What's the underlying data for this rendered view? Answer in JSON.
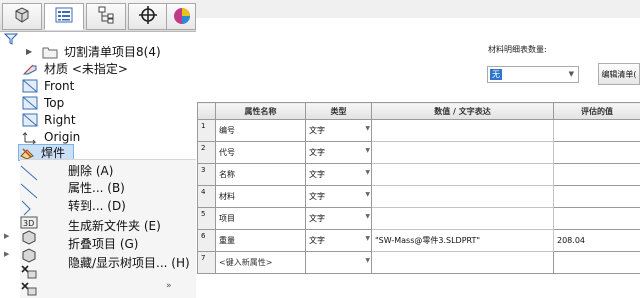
{
  "tabs": [
    {
      "icon": "feature-manager-icon"
    },
    {
      "icon": "property-manager-icon"
    },
    {
      "icon": "configuration-manager-icon"
    },
    {
      "icon": "dimxpert-icon"
    },
    {
      "icon": "display-manager-icon"
    }
  ],
  "tree": {
    "items": [
      {
        "label": "切割清单项目8(4)",
        "icon": "folder-icon"
      },
      {
        "label": "材质 <未指定>",
        "icon": "material-icon"
      },
      {
        "label": "Front",
        "icon": "plane-icon"
      },
      {
        "label": "Top",
        "icon": "plane-icon"
      },
      {
        "label": "Right",
        "icon": "plane-icon"
      },
      {
        "label": "Origin",
        "icon": "origin-icon"
      },
      {
        "label": "焊件",
        "icon": "weldment-icon",
        "selected": true
      }
    ]
  },
  "context_menu": {
    "items": [
      {
        "label": "删除 (A)"
      },
      {
        "label": "属性... (B)"
      },
      {
        "label": "转到... (D)"
      },
      {
        "label": "生成新文件夹 (E)"
      },
      {
        "label": "折叠项目 (G)"
      },
      {
        "label": "隐藏/显示树项目... (H)"
      }
    ],
    "more_glyph": "»"
  },
  "cutlist_props": {
    "quantity_label": "材料明细表数量:",
    "quantity_value": "无",
    "edit_button": "编辑清单(",
    "columns": [
      "属性名称",
      "类型",
      "数值 / 文字表达",
      "评估的值"
    ],
    "rows": [
      {
        "num": "1",
        "name": "编号",
        "type": "文字",
        "value": "",
        "evaluated": ""
      },
      {
        "num": "2",
        "name": "代号",
        "type": "文字",
        "value": "",
        "evaluated": ""
      },
      {
        "num": "3",
        "name": "名称",
        "type": "文字",
        "value": "",
        "evaluated": ""
      },
      {
        "num": "4",
        "name": "材料",
        "type": "文字",
        "value": "",
        "evaluated": ""
      },
      {
        "num": "5",
        "name": "项目",
        "type": "文字",
        "value": "",
        "evaluated": ""
      },
      {
        "num": "6",
        "name": "重量",
        "type": "文字",
        "value": "\"SW-Mass@零件3.SLDPRT\"",
        "evaluated": "208.04"
      },
      {
        "num": "7",
        "name": "<键入新属性>",
        "type": "",
        "value": "",
        "evaluated": ""
      }
    ]
  }
}
